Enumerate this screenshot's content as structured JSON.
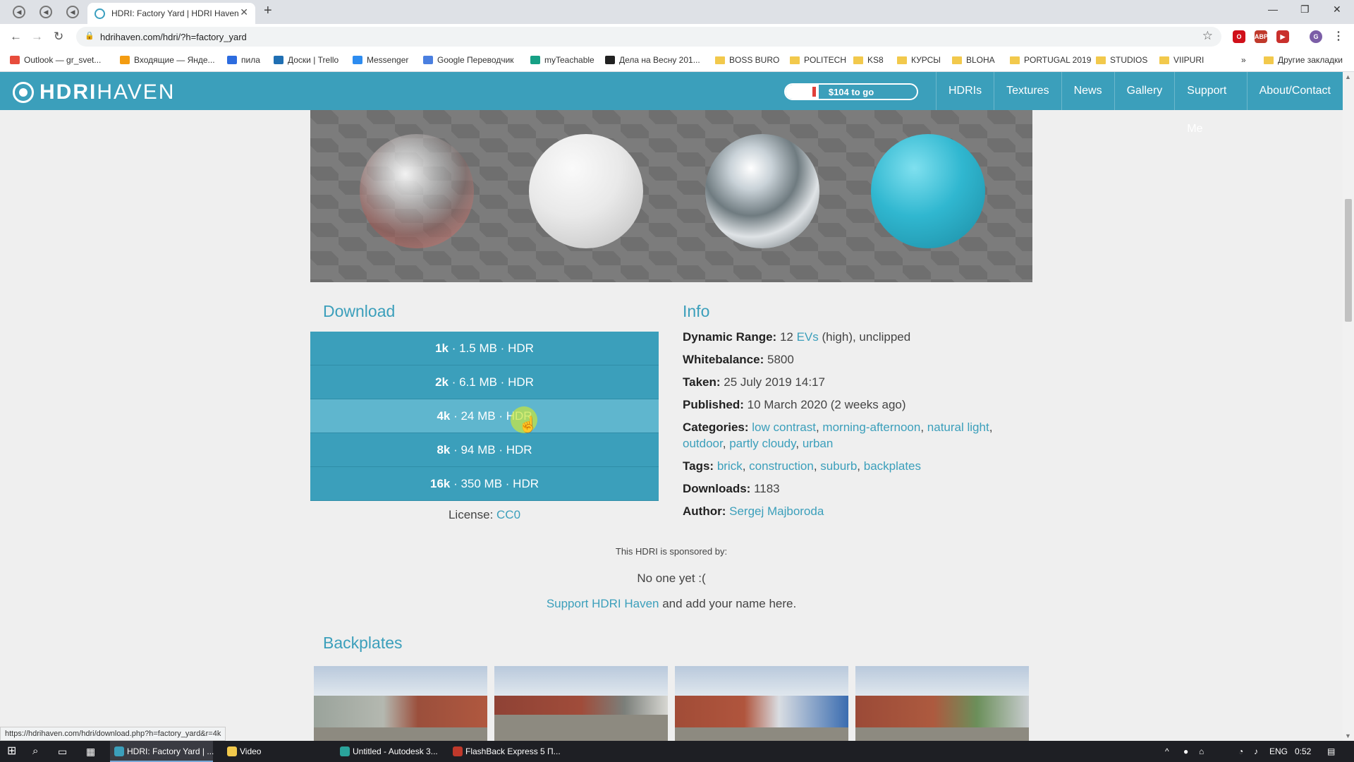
{
  "browser": {
    "tab_title": "HDRI: Factory Yard | HDRI Haven",
    "url": "hdrihaven.com/hdri/?h=factory_yard",
    "status_url": "https://hdrihaven.com/hdri/download.php?h=factory_yard&r=4k"
  },
  "bookmarks": [
    {
      "label": "Outlook — gr_svet...",
      "icon": "microsoft-icon",
      "color": "#e74c3c"
    },
    {
      "label": "Входящие — Янде...",
      "icon": "mail-icon",
      "color": "#f39c12"
    },
    {
      "label": "пила",
      "icon": "doc-icon",
      "color": "#2d6cdf"
    },
    {
      "label": "Доски | Trello",
      "icon": "trello-icon",
      "color": "#1f6fb3"
    },
    {
      "label": "Messenger",
      "icon": "messenger-icon",
      "color": "#2d8cf0"
    },
    {
      "label": "Google Переводчик",
      "icon": "translate-icon",
      "color": "#4a7fe0"
    },
    {
      "label": "myTeachable",
      "icon": "teachable-icon",
      "color": "#16a085"
    },
    {
      "label": "Дела на Весну 201...",
      "icon": "notion-icon",
      "color": "#222222"
    },
    {
      "label": "BOSS BURO",
      "icon": "folder-icon"
    },
    {
      "label": "POLITECH",
      "icon": "folder-icon"
    },
    {
      "label": "KS8",
      "icon": "folder-icon"
    },
    {
      "label": "КУРСЫ",
      "icon": "folder-icon"
    },
    {
      "label": "BLOHA",
      "icon": "folder-icon"
    },
    {
      "label": "PORTUGAL 2019",
      "icon": "folder-icon"
    },
    {
      "label": "STUDIOS",
      "icon": "folder-icon"
    },
    {
      "label": "VIIPURI",
      "icon": "folder-icon"
    }
  ],
  "bookmarks_more": "»",
  "bookmarks_other": "Другие закладки",
  "site": {
    "logo_bold": "HDRI",
    "logo_thin": "HAVEN",
    "funding_label": "$104 to go",
    "funding_progress": 0.25,
    "nav": [
      "HDRIs",
      "Textures",
      "News",
      "Gallery",
      "Support Me",
      "About/Contact"
    ]
  },
  "download": {
    "title": "Download",
    "options": [
      {
        "res": "1k",
        "rest": " · 1.5 MB · HDR"
      },
      {
        "res": "2k",
        "rest": " · 6.1 MB · HDR"
      },
      {
        "res": "4k",
        "rest": " · 24 MB · HDR"
      },
      {
        "res": "8k",
        "rest": " · 94 MB · HDR"
      },
      {
        "res": "16k",
        "rest": " · 350 MB · HDR"
      }
    ],
    "license_label": "License: ",
    "license_value": "CC0"
  },
  "info": {
    "title": "Info",
    "dynamic_range_label": "Dynamic Range:",
    "dynamic_range_value": "12",
    "dynamic_range_link": "EVs",
    "dynamic_range_rest": "(high), unclipped",
    "whitebalance_label": "Whitebalance:",
    "whitebalance_value": "5800",
    "taken_label": "Taken:",
    "taken_value": "25 July 2019 14:17",
    "published_label": "Published:",
    "published_value": "10 March 2020 (2 weeks ago)",
    "categories_label": "Categories:",
    "categories": [
      "low contrast",
      "morning-afternoon",
      "natural light",
      "outdoor",
      "partly cloudy",
      "urban"
    ],
    "tags_label": "Tags:",
    "tags": [
      "brick",
      "construction",
      "suburb",
      "backplates"
    ],
    "downloads_label": "Downloads:",
    "downloads_value": "1183",
    "author_label": "Author:",
    "author_value": "Sergej Majboroda"
  },
  "sponsor": {
    "heading": "This HDRI is sponsored by:",
    "none": "No one yet :(",
    "support_link": "Support HDRI Haven",
    "support_rest": " and add your name here."
  },
  "backplates": {
    "title": "Backplates"
  },
  "taskbar": {
    "apps": [
      {
        "label": "HDRI: Factory Yard | ...",
        "color": "#3b9fbb",
        "active": true
      },
      {
        "label": "Video",
        "color": "#f2c94c",
        "active": false
      },
      {
        "label": "Untitled - Autodesk 3...",
        "color": "#2aa39b",
        "active": false
      },
      {
        "label": "FlashBack Express 5 П...",
        "color": "#c0392b",
        "active": false
      }
    ],
    "lang": "ENG",
    "time": "0:52"
  }
}
